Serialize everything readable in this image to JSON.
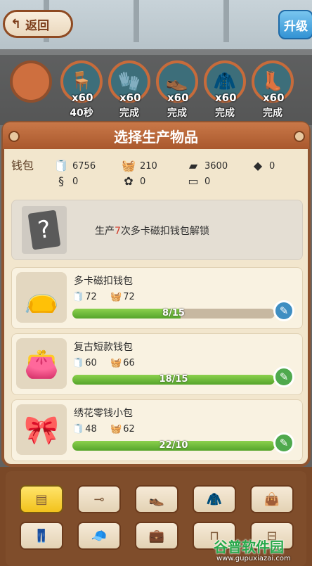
{
  "header": {
    "back_label": "返回",
    "upgrade_label": "升级"
  },
  "queue": [
    {
      "icon": "empty-slot-icon",
      "count": "",
      "status": ""
    },
    {
      "icon": "stool-icon",
      "count": "x60",
      "status": "40秒"
    },
    {
      "icon": "gloves-icon",
      "count": "x60",
      "status": "完成"
    },
    {
      "icon": "shoe-icon",
      "count": "x60",
      "status": "完成"
    },
    {
      "icon": "jacket-icon",
      "count": "x60",
      "status": "完成"
    },
    {
      "icon": "boot-icon",
      "count": "x60",
      "status": "完成"
    }
  ],
  "panel": {
    "title": "选择生产物品"
  },
  "wallet": {
    "label": "钱包",
    "resources": [
      {
        "icon": "cloth-rolls-icon",
        "value": "6756"
      },
      {
        "icon": "leather-basket-icon",
        "value": "210"
      },
      {
        "icon": "metal-bar-icon",
        "value": "3600"
      },
      {
        "icon": "dark-fabric-icon",
        "value": "0"
      },
      {
        "icon": "thread-icon",
        "value": "0"
      },
      {
        "icon": "cotton-icon",
        "value": "0"
      },
      {
        "icon": "wood-plank-icon",
        "value": "0"
      }
    ]
  },
  "locked_item": {
    "text_prefix": "生产",
    "text_count": "7",
    "text_suffix": "次多卡磁扣钱包解锁"
  },
  "items": [
    {
      "name": "多卡磁扣钱包",
      "icon": "pouch-wallet-icon",
      "cost1": "72",
      "cost2": "72",
      "progress_text": "8/15",
      "progress": 0.533,
      "edit_color": "blue"
    },
    {
      "name": "复古短款钱包",
      "icon": "leather-wallet-icon",
      "cost1": "60",
      "cost2": "66",
      "progress_text": "18/15",
      "progress": 1.0,
      "edit_color": "green"
    },
    {
      "name": "绣花零钱小包",
      "icon": "coin-purse-icon",
      "cost1": "48",
      "cost2": "62",
      "progress_text": "22/10",
      "progress": 1.0,
      "edit_color": "green"
    }
  ],
  "tabs": [
    {
      "icon": "fabric-icon",
      "active": true
    },
    {
      "icon": "belt-icon",
      "active": false
    },
    {
      "icon": "shoe-tab-icon",
      "active": false
    },
    {
      "icon": "coat-icon",
      "active": false
    },
    {
      "icon": "bag-icon",
      "active": false
    },
    {
      "icon": "pants-icon",
      "active": false
    },
    {
      "icon": "hat-icon",
      "active": false
    },
    {
      "icon": "suitcase-icon",
      "active": false
    },
    {
      "icon": "table-icon",
      "active": false
    },
    {
      "icon": "furniture-icon",
      "active": false
    }
  ],
  "watermark": {
    "logo": "谷普软件园",
    "url": "www.gupuxiazai.com"
  }
}
